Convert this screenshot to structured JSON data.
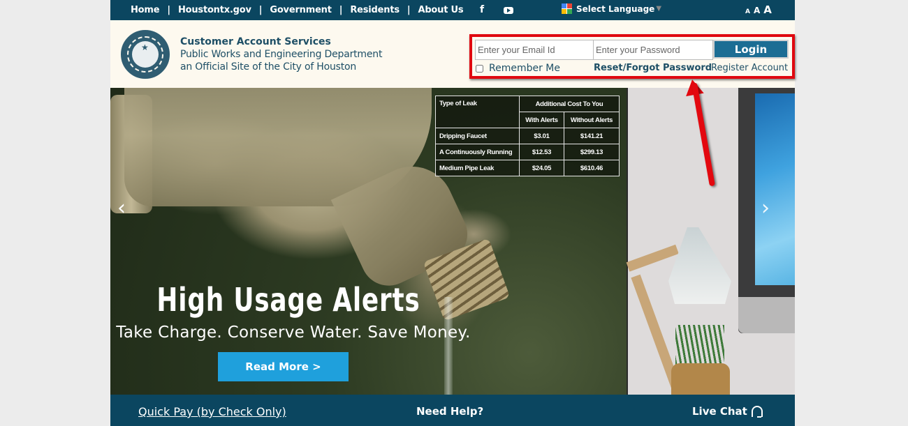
{
  "topnav": {
    "links": [
      "Home",
      "Houstontx.gov",
      "Government",
      "Residents",
      "About Us"
    ],
    "separator": "|",
    "social": {
      "facebook": "f",
      "youtube_icon": "youtube-icon"
    },
    "language": "Select Language",
    "language_caret": "▼",
    "font_sizes": [
      "A",
      "A",
      "A"
    ]
  },
  "header": {
    "title": "Customer Account Services",
    "department": "Public Works and Engineering Department",
    "tagline": "an Official Site of the City of Houston",
    "seal_icon": "city-seal-icon"
  },
  "login": {
    "email_placeholder": "Enter your Email Id",
    "password_placeholder": "Enter your Password",
    "login_label": "Login",
    "remember_label": "Remember Me",
    "reset_label": "Reset/Forgot Password",
    "register_label": "Register Account",
    "highlight_color": "#e0080f"
  },
  "hero": {
    "prev": "‹",
    "next": "›",
    "headline": "High Usage Alerts",
    "subline": "Take Charge. Conserve Water. Save Money.",
    "cta": "Read More >",
    "table": {
      "header_type": "Type of Leak",
      "header_cost": "Additional Cost To You",
      "col_with": "With Alerts",
      "col_without": "Without Alerts",
      "rows": [
        {
          "type": "Dripping Faucet",
          "with": "$3.01",
          "without": "$141.21"
        },
        {
          "type": "A Continuously Running",
          "with": "$12.53",
          "without": "$299.13"
        },
        {
          "type": "Medium Pipe Leak",
          "with": "$24.05",
          "without": "$610.46"
        }
      ]
    }
  },
  "footer": {
    "quick_pay": "Quick Pay (by Check Only)",
    "need_help": "Need Help?",
    "live_chat": "Live Chat"
  },
  "colors": {
    "nav_bg": "#0b4660",
    "header_bg": "#fdf9ef",
    "login_button": "#1c6d94",
    "cta_button": "#1fa0dc",
    "text_dark": "#1e4f66"
  }
}
